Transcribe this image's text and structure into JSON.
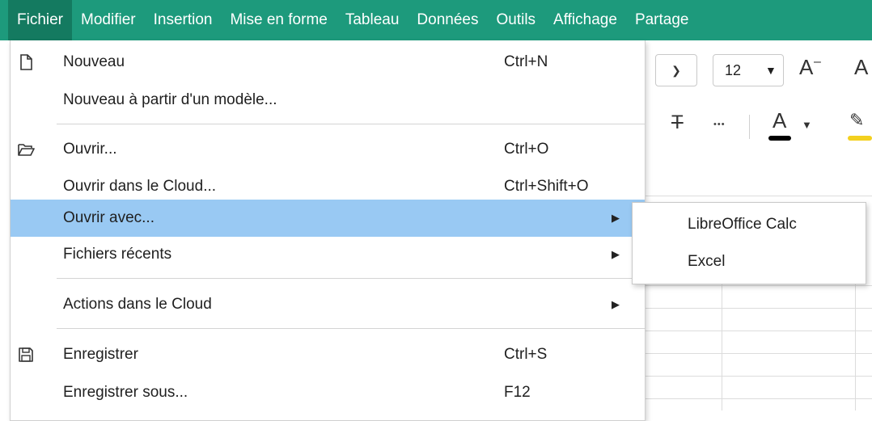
{
  "menubar": {
    "items": [
      "Fichier",
      "Modifier",
      "Insertion",
      "Mise en forme",
      "Tableau",
      "Données",
      "Outils",
      "Affichage",
      "Partage"
    ],
    "active_index": 0,
    "bg_color": "#1d9a7c",
    "active_color": "#147a60"
  },
  "toolbar": {
    "font_size": "12",
    "grow_font_glyph": "A",
    "strike_glyph": "T",
    "more_glyph": "•••",
    "text_color_glyph": "A",
    "text_color": "#000000",
    "highlight_color": "#f3d01f"
  },
  "file_menu": {
    "items": [
      {
        "label": "Nouveau",
        "shortcut": "Ctrl+N",
        "icon": "new-document-icon"
      },
      {
        "label": "Nouveau à partir d'un modèle...",
        "shortcut": ""
      },
      {
        "label": "Ouvrir...",
        "shortcut": "Ctrl+O",
        "icon": "open-folder-icon"
      },
      {
        "label": "Ouvrir dans le Cloud...",
        "shortcut": "Ctrl+Shift+O"
      },
      {
        "label": "Ouvrir avec...",
        "shortcut": "",
        "submenu": true,
        "highlighted": true
      },
      {
        "label": "Fichiers récents",
        "shortcut": "",
        "submenu": true
      },
      {
        "label": "Actions dans le Cloud",
        "shortcut": "",
        "submenu": true
      },
      {
        "label": "Enregistrer",
        "shortcut": "Ctrl+S",
        "icon": "save-icon"
      },
      {
        "label": "Enregistrer sous...",
        "shortcut": "F12"
      }
    ],
    "highlight_color": "#99c9f3"
  },
  "open_with_submenu": {
    "items": [
      "LibreOffice Calc",
      "Excel"
    ]
  }
}
